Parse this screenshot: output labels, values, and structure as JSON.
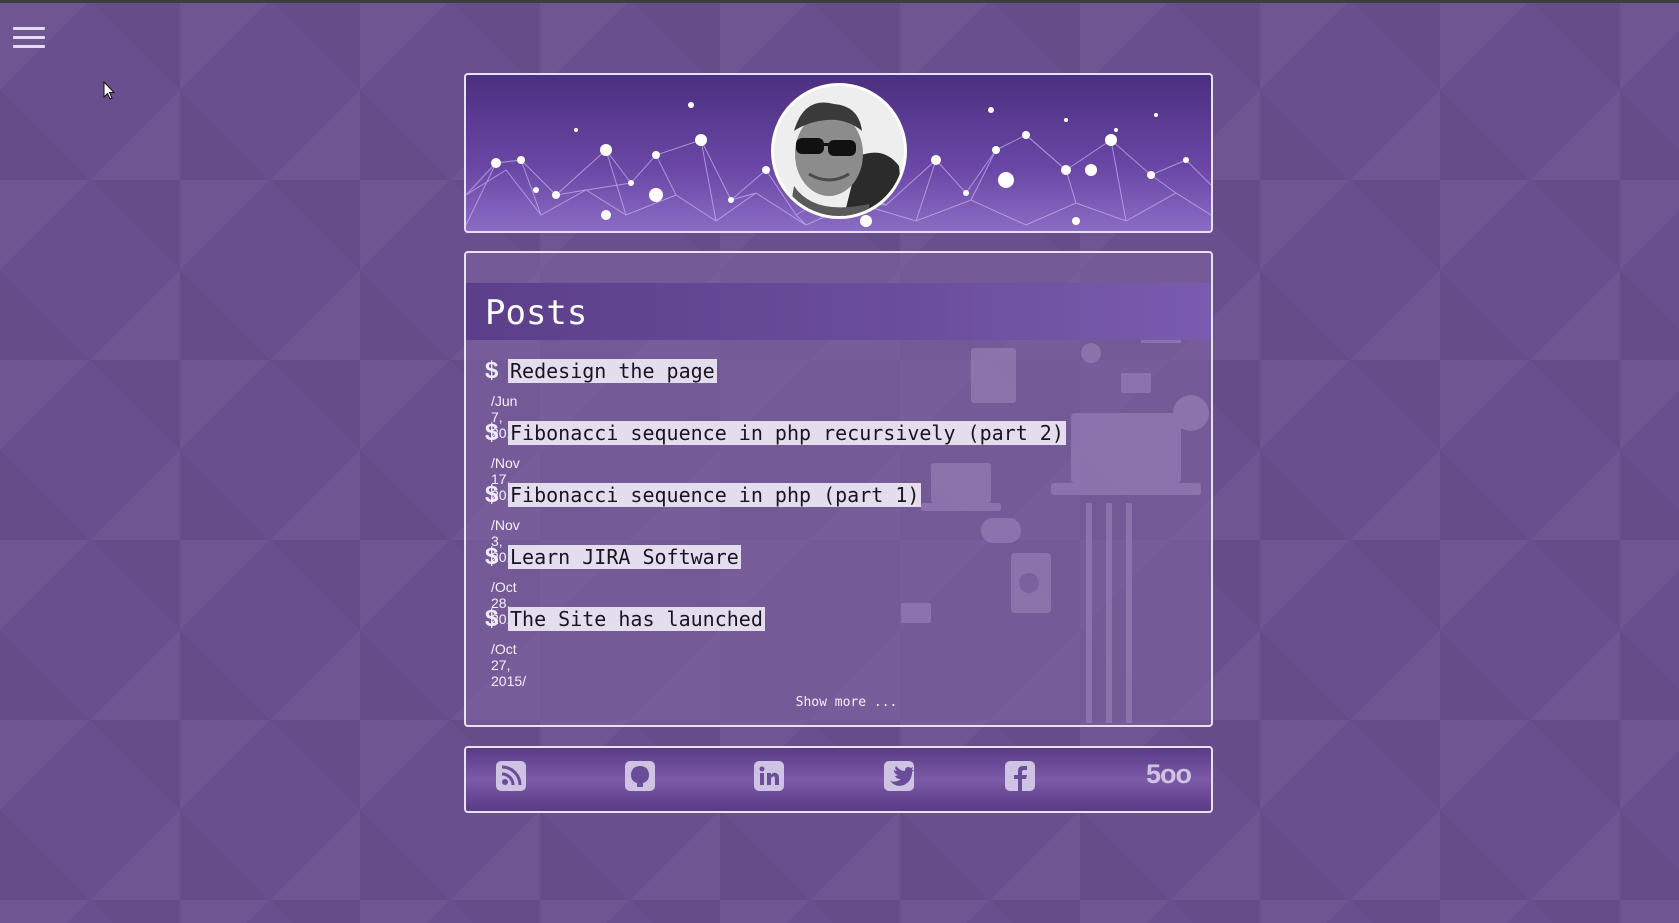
{
  "menu": {
    "icon": "hamburger-menu-icon"
  },
  "header": {
    "avatar_icon": "profile-avatar",
    "banner": "network-banner"
  },
  "posts": {
    "title": "Posts",
    "prompt_symbol": "$",
    "items": [
      {
        "title": "Redesign the page",
        "date": "/Jun 7, 2017/"
      },
      {
        "title": "Fibonacci sequence in php recursively (part 2)",
        "date": "/Nov 17, 2015/"
      },
      {
        "title": "Fibonacci sequence in php (part 1)",
        "date": "/Nov 3, 2015/"
      },
      {
        "title": "Learn JIRA Software",
        "date": "/Oct 28, 2015/"
      },
      {
        "title": "The Site has launched",
        "date": "/Oct 27, 2015/"
      }
    ],
    "show_more": "Show more ..."
  },
  "social": {
    "icons": [
      "rss-icon",
      "github-icon",
      "linkedin-icon",
      "twitter-icon",
      "facebook-icon",
      "500px-icon"
    ],
    "label_500px": "5oo"
  },
  "colors": {
    "background": "#6a4f8e",
    "header_bar": "#5c3f8a",
    "link_highlight": "#e4dded",
    "icon_tint": "#cfc3e4"
  }
}
